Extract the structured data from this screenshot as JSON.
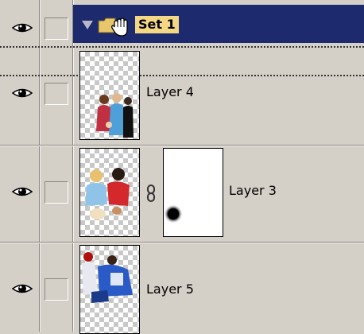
{
  "layers_panel": {
    "set": {
      "name": "Set 1",
      "expanded": true,
      "selected": true
    },
    "layers": [
      {
        "name": "Layer 4",
        "visible": true,
        "has_mask": false
      },
      {
        "name": "Layer 3",
        "visible": true,
        "has_mask": true,
        "mask_linked": true
      },
      {
        "name": "Layer 5",
        "visible": true,
        "has_mask": false
      }
    ]
  },
  "icons": {
    "visibility": "eye-icon",
    "expand": "triangle-down-icon",
    "set": "folder-icon",
    "cursor": "hand-cursor-icon",
    "mask_link": "chain-link-icon"
  },
  "colors": {
    "panel_bg": "#d4d0c8",
    "selection_bg": "#1e2a6e",
    "set_label_bg": "#f4d784"
  }
}
